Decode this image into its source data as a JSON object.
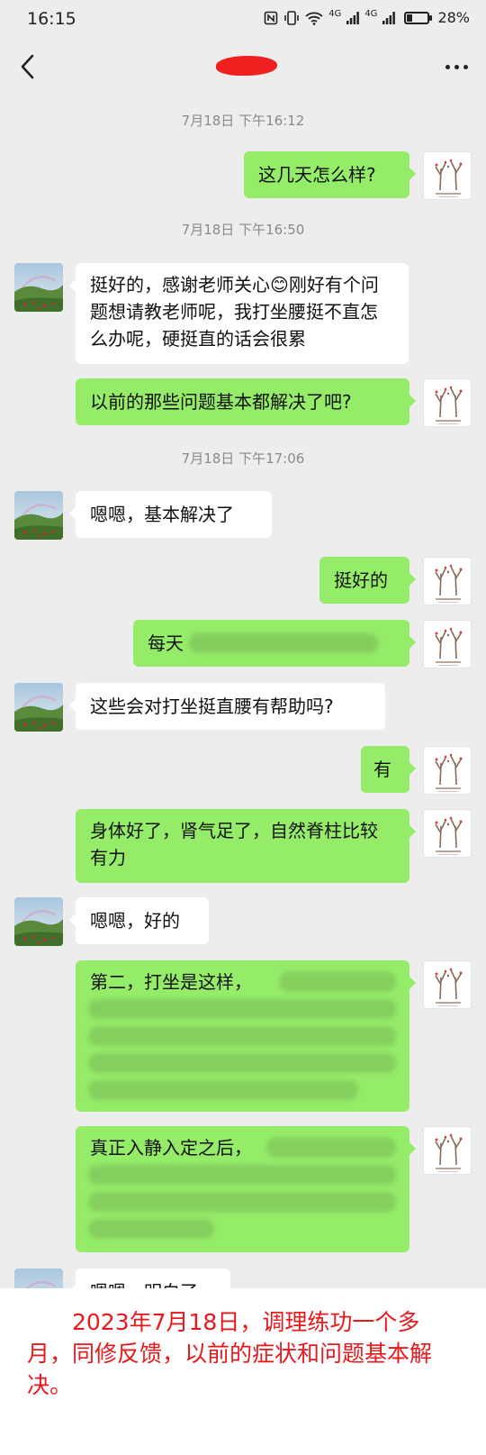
{
  "status_bar": {
    "time": "16:15",
    "network_1": "4G",
    "network_2": "4G",
    "battery_text": "28%",
    "battery_level": 0.28,
    "icons": [
      "nfc-icon",
      "vibrate-icon",
      "wifi-icon",
      "signal-icon",
      "signal-icon",
      "battery-icon"
    ]
  },
  "nav": {
    "back_icon": "chevron-left-icon",
    "title": "",
    "more_icon": "ellipsis-icon"
  },
  "colors": {
    "background": "#ededed",
    "bubble_out": "#95ec69",
    "bubble_in": "#ffffff",
    "timestamp": "#8a8a8a",
    "caption_text": "#e8191c",
    "redaction": "#f02020"
  },
  "chat": {
    "timestamps": [
      "7月18日 下午16:12",
      "7月18日 下午16:50",
      "7月18日 下午17:06"
    ],
    "messages": [
      {
        "side": "out",
        "text": "这几天怎么样?"
      },
      {
        "side": "in",
        "text": "挺好的，感谢老师关心😊刚好有个问题想请教老师呢，我打坐腰挺不直怎么办呢，硬挺直的话会很累"
      },
      {
        "side": "out",
        "text": "以前的那些问题基本都解决了吧?"
      },
      {
        "side": "in",
        "text": "嗯嗯，基本解决了"
      },
      {
        "side": "out",
        "text": "挺好的"
      },
      {
        "side": "out",
        "text": "每天"
      },
      {
        "side": "in",
        "text": "这些会对打坐挺直腰有帮助吗?"
      },
      {
        "side": "out",
        "text": "有"
      },
      {
        "side": "out",
        "text": "身体好了，肾气足了，自然脊柱比较有力"
      },
      {
        "side": "in",
        "text": "嗯嗯，好的"
      },
      {
        "side": "out",
        "text": "第二，打坐是这样，"
      },
      {
        "side": "out",
        "text": "真正入静入定之后，"
      },
      {
        "side": "in",
        "text": "嗯嗯，明白了"
      }
    ]
  },
  "caption": {
    "text": "2023年7月18日，调理练功一个多月，同修反馈，以前的症状和问题基本解决。"
  }
}
